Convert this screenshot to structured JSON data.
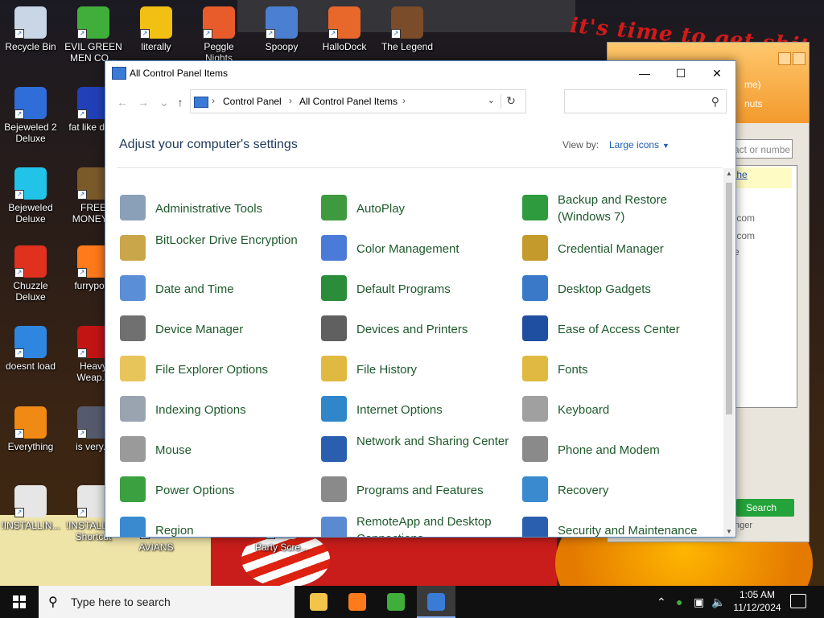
{
  "desktop": {
    "heading": "it's time to get shit",
    "icons": [
      {
        "label": "Recycle Bin",
        "color": "#c9d6e6"
      },
      {
        "label": "EVIL GREEN MEN CO...",
        "color": "#3fae3a"
      },
      {
        "label": "literally",
        "color": "#f2c012"
      },
      {
        "label": "Peggle Nights",
        "color": "#e85c2b"
      },
      {
        "label": "Spoopy",
        "color": "#4b7fd1"
      },
      {
        "label": "HalloDock",
        "color": "#e8672a"
      },
      {
        "label": "The Legend",
        "color": "#7a4c2a"
      },
      {
        "label": "Bejeweled 2 Deluxe",
        "color": "#2f6dd8"
      },
      {
        "label": "fat like da...",
        "color": "#2240b8"
      },
      {
        "label": "Bejeweled Deluxe",
        "color": "#22c3e8"
      },
      {
        "label": "FREE MONEY...",
        "color": "#7b5a2a"
      },
      {
        "label": "Chuzzle Deluxe",
        "color": "#e0301e"
      },
      {
        "label": "furrypo...",
        "color": "#ff7a1a"
      },
      {
        "label": "doesnt load",
        "color": "#2f86e0"
      },
      {
        "label": "Heavy Weap...",
        "color": "#c31414"
      },
      {
        "label": "Everything",
        "color": "#f08a14"
      },
      {
        "label": "is very...",
        "color": "#555b6e"
      },
      {
        "label": "!INSTALLIN...",
        "color": "#e6e6e6"
      },
      {
        "label": "!INSTALL... - Shortcut",
        "color": "#e6e6e6"
      },
      {
        "label": "AVIANS",
        "color": "#cfcfcf"
      },
      {
        "label": "Party Scre...",
        "color": "#cfcfcf"
      }
    ]
  },
  "bg_window": {
    "title_lines": [
      "me)",
      "nuts"
    ],
    "field_placeholder": "act or numbe",
    "link": "the",
    "rows": [
      ".com",
      ".com",
      "e"
    ],
    "search_label": "Search",
    "footer": "nger"
  },
  "control_panel": {
    "title": "All Control Panel Items",
    "breadcrumb": [
      "Control Panel",
      "All Control Panel Items"
    ],
    "heading": "Adjust your computer's settings",
    "view_by_label": "View by:",
    "view_by_value": "Large icons",
    "items": [
      {
        "label": "Administrative Tools",
        "color": "#8aa0b8"
      },
      {
        "label": "AutoPlay",
        "color": "#3f9a3f"
      },
      {
        "label": "Backup and Restore (Windows 7)",
        "color": "#2e9b3e"
      },
      {
        "label": "BitLocker Drive Encryption",
        "color": "#c9a64a"
      },
      {
        "label": "Color Management",
        "color": "#4a7bd8"
      },
      {
        "label": "Credential Manager",
        "color": "#c49a2c"
      },
      {
        "label": "Date and Time",
        "color": "#5a8fd8"
      },
      {
        "label": "Default Programs",
        "color": "#2b8c3a"
      },
      {
        "label": "Desktop Gadgets",
        "color": "#3a78c8"
      },
      {
        "label": "Device Manager",
        "color": "#707070"
      },
      {
        "label": "Devices and Printers",
        "color": "#606060"
      },
      {
        "label": "Ease of Access Center",
        "color": "#1f4fa0"
      },
      {
        "label": "File Explorer Options",
        "color": "#e8c55a"
      },
      {
        "label": "File History",
        "color": "#e0b940"
      },
      {
        "label": "Fonts",
        "color": "#e0b940"
      },
      {
        "label": "Indexing Options",
        "color": "#9aa4b0"
      },
      {
        "label": "Internet Options",
        "color": "#2f86c8"
      },
      {
        "label": "Keyboard",
        "color": "#a0a0a0"
      },
      {
        "label": "Mouse",
        "color": "#9a9a9a"
      },
      {
        "label": "Network and Sharing Center",
        "color": "#2a5fb0"
      },
      {
        "label": "Phone and Modem",
        "color": "#8a8a8a"
      },
      {
        "label": "Power Options",
        "color": "#3aa040"
      },
      {
        "label": "Programs and Features",
        "color": "#8a8a8a"
      },
      {
        "label": "Recovery",
        "color": "#3a8ad0"
      },
      {
        "label": "Region",
        "color": "#3a8ad0"
      },
      {
        "label": "RemoteApp and Desktop Connections",
        "color": "#5a8ad0"
      },
      {
        "label": "Security and Maintenance",
        "color": "#2a5fb0"
      }
    ]
  },
  "taskbar": {
    "search_placeholder": "Type here to search",
    "apps": [
      {
        "name": "file-explorer",
        "color": "#f2c44a"
      },
      {
        "name": "firefox",
        "color": "#ff7a1a"
      },
      {
        "name": "messenger",
        "color": "#3fae3a"
      },
      {
        "name": "control-panel",
        "color": "#3a7bd5"
      }
    ],
    "time": "1:05 AM",
    "date": "11/12/2024"
  }
}
